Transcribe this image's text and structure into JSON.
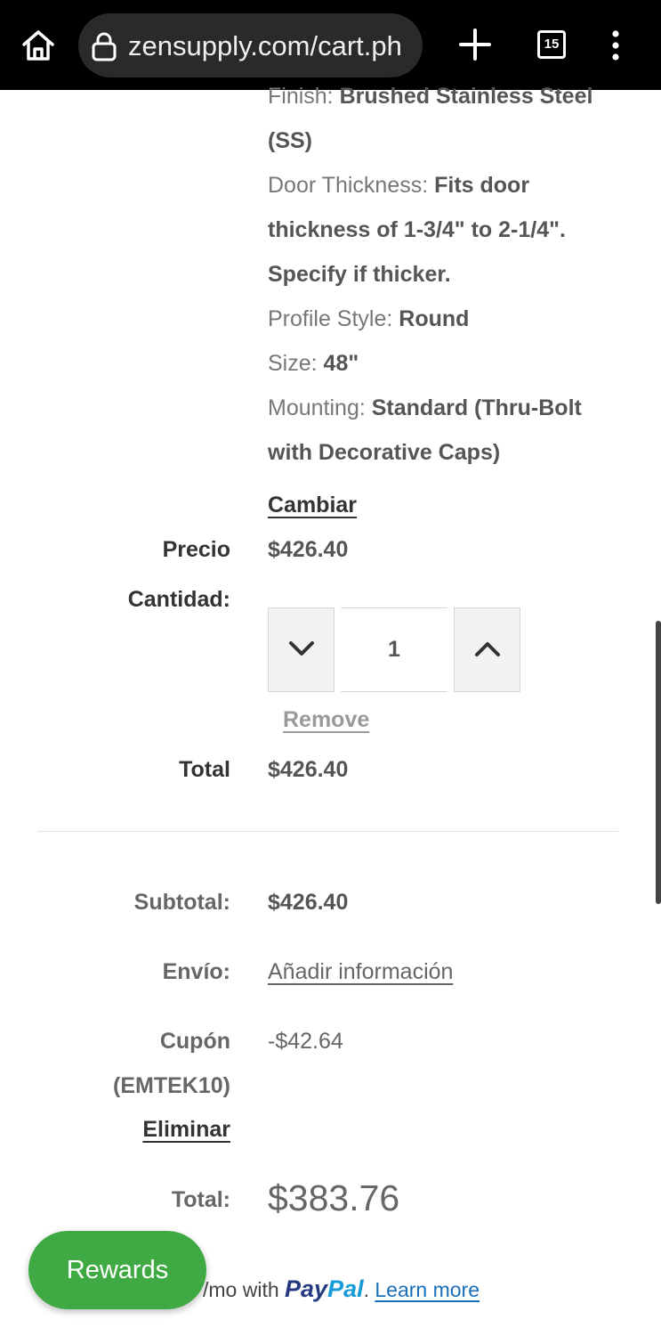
{
  "browser": {
    "url": "zensupply.com/cart.ph",
    "tab_count": "15"
  },
  "product_options": [
    {
      "label": "Finish:",
      "value": "Brushed Stainless Steel"
    },
    {
      "label": "",
      "value": "(SS)"
    },
    {
      "label": "Door Thickness:",
      "value": "Fits door"
    },
    {
      "label": "",
      "value": "thickness of 1-3/4\" to 2-1/4\"."
    },
    {
      "label": "",
      "value": "Specify if thicker."
    },
    {
      "label": "Profile Style:",
      "value": "Round"
    },
    {
      "label": "Size:",
      "value": "48\""
    },
    {
      "label": "Mounting:",
      "value": "Standard (Thru-Bolt"
    },
    {
      "label": "",
      "value": "with Decorative Caps)"
    }
  ],
  "item": {
    "change_link": "Cambiar",
    "price_label": "Precio",
    "price_value": "$426.40",
    "quantity_label": "Cantidad:",
    "quantity_value": "1",
    "remove_link": "Remove",
    "total_label": "Total",
    "total_value": "$426.40"
  },
  "summary": {
    "subtotal_label": "Subtotal:",
    "subtotal_value": "$426.40",
    "shipping_label": "Envío:",
    "shipping_link": "Añadir información",
    "coupon_label": "Cupón",
    "coupon_code": "(EMTEK10)",
    "coupon_remove": "Eliminar",
    "coupon_value": "-$42.64",
    "total_label": "Total:",
    "total_value": "$383.76"
  },
  "rewards_button": "Rewards",
  "paypal": {
    "text": "/mo with",
    "logo_part1": "Pay",
    "logo_part2": "Pal",
    "period": ".",
    "learn_more": "Learn more"
  },
  "icons": [
    "home-icon",
    "lock-icon",
    "plus-icon",
    "tab-switcher-icon",
    "more-vert-icon",
    "chevron-down-icon",
    "chevron-up-icon"
  ]
}
